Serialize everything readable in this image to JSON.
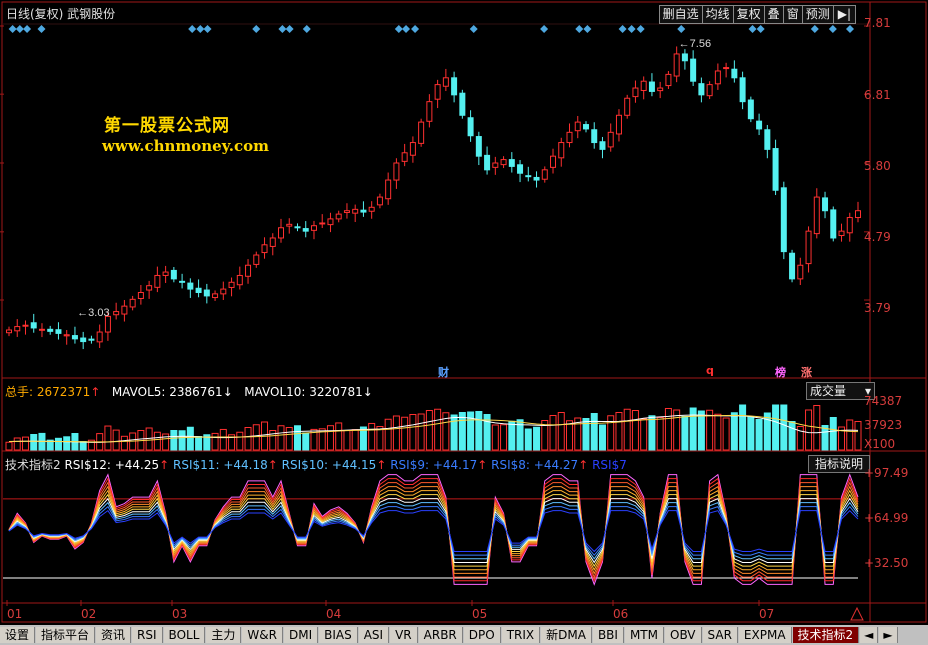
{
  "window": {
    "title": "日线(复权)  武钢股份"
  },
  "toolbar": {
    "buttons": [
      "删自选",
      "均线",
      "复权",
      "叠",
      "窗",
      "预测"
    ],
    "arrow": "▶|"
  },
  "watermark": {
    "line1": "第一股票公式网",
    "line2": "www.chnmoney.com"
  },
  "price_panel": {
    "axis_labels": [
      "7.81",
      "6.81",
      "5.80",
      "4.79",
      "3.79"
    ],
    "high_mark": "←7.56",
    "low_mark": "←3.03",
    "flags": [
      {
        "text": "财",
        "color": "#5aa0ff"
      },
      {
        "text": "q",
        "color": "#ff3030"
      },
      {
        "text": "榜",
        "color": "#ff66ff"
      },
      {
        "text": "涨",
        "color": "#ff7070"
      }
    ]
  },
  "volume_panel": {
    "legend": {
      "total_label": "总手: ",
      "total_value": "2672371",
      "total_arrow": "↑",
      "mavol5_label": "MAVOL5: ",
      "mavol5_value": "2386761",
      "mavol5_arrow": "↓",
      "mavol10_label": "MAVOL10: ",
      "mavol10_value": "3220781",
      "mavol10_arrow": "↓"
    },
    "selector": "成交量",
    "axis_labels": [
      "74387",
      "37923",
      "X100"
    ]
  },
  "indicator_panel": {
    "name": "技术指标2",
    "series": [
      {
        "label": "RSI$12: ",
        "value": "+44.25",
        "arrow": "↑",
        "color": "#ffffff"
      },
      {
        "label": "RSI$11: ",
        "value": "+44.18",
        "arrow": "↑",
        "color": "#60c0ff"
      },
      {
        "label": "RSI$10: ",
        "value": "+44.15",
        "arrow": "↑",
        "color": "#60c0ff"
      },
      {
        "label": "RSI$9: ",
        "value": "+44.17",
        "arrow": "↑",
        "color": "#3a7cff"
      },
      {
        "label": "RSI$8: ",
        "value": "+44.27",
        "arrow": "↑",
        "color": "#3a7cff"
      },
      {
        "label": "RSI$7",
        "value": "",
        "arrow": "",
        "color": "#2a40ff"
      }
    ],
    "help_button": "指标说明",
    "axis_labels": [
      "+97.49",
      "+64.99",
      "+32.50"
    ]
  },
  "x_axis": {
    "labels": [
      "01",
      "02",
      "03",
      "04",
      "05",
      "06",
      "07"
    ]
  },
  "bottom_tabs": [
    "设置",
    "指标平台",
    "资讯",
    "RSI",
    "BOLL",
    "主力",
    "W&R",
    "DMI",
    "BIAS",
    "ASI",
    "VR",
    "ARBR",
    "DPO",
    "TRIX",
    "新DMA",
    "BBI",
    "MTM",
    "OBV",
    "SAR",
    "EXPMA",
    "技术指标2"
  ],
  "active_tab": "技术指标2",
  "colors": {
    "up": "#ff3030",
    "down": "#54f0f0",
    "axis": "#a01818",
    "label": "#d63c3c",
    "bg": "#000000"
  },
  "chart_data": {
    "type": "candlestick",
    "title": "武钢股份 日线(复权)",
    "ylim": [
      3.03,
      7.81
    ],
    "price_labels": [
      7.81,
      6.81,
      5.8,
      4.79,
      3.79
    ],
    "high": 7.56,
    "low": 3.03,
    "months": [
      "01",
      "02",
      "03",
      "04",
      "05",
      "06",
      "07"
    ],
    "close_series": [
      3.35,
      3.4,
      3.42,
      3.38,
      3.36,
      3.33,
      3.3,
      3.28,
      3.22,
      3.18,
      3.2,
      3.32,
      3.55,
      3.62,
      3.7,
      3.8,
      3.9,
      4.0,
      4.15,
      4.2,
      4.1,
      4.05,
      3.95,
      3.9,
      3.85,
      3.88,
      3.95,
      4.05,
      4.15,
      4.3,
      4.45,
      4.6,
      4.7,
      4.85,
      4.9,
      4.85,
      4.8,
      4.88,
      4.92,
      4.98,
      5.05,
      5.1,
      5.12,
      5.08,
      5.15,
      5.3,
      5.55,
      5.8,
      5.95,
      6.1,
      6.4,
      6.7,
      6.95,
      7.05,
      6.8,
      6.5,
      6.2,
      5.9,
      5.7,
      5.8,
      5.85,
      5.75,
      5.65,
      5.6,
      5.55,
      5.7,
      5.9,
      6.1,
      6.25,
      6.4,
      6.3,
      6.1,
      6.0,
      6.25,
      6.5,
      6.75,
      6.9,
      7.0,
      6.85,
      6.9,
      7.1,
      7.4,
      7.3,
      7.0,
      6.8,
      6.95,
      7.15,
      7.2,
      7.05,
      6.7,
      6.45,
      6.3,
      6.0,
      5.4,
      4.5,
      4.1,
      4.3,
      4.8,
      5.3,
      5.1,
      4.7,
      4.8,
      5.0,
      5.1
    ],
    "volume_axis": [
      74387,
      37923
    ],
    "volume_unit": "X100",
    "rsi_axis": [
      97.49,
      64.99,
      32.5
    ],
    "rsi_latest": {
      "RSI$12": 44.25,
      "RSI$11": 44.18,
      "RSI$10": 44.15,
      "RSI$9": 44.17,
      "RSI$8": 44.27
    }
  }
}
